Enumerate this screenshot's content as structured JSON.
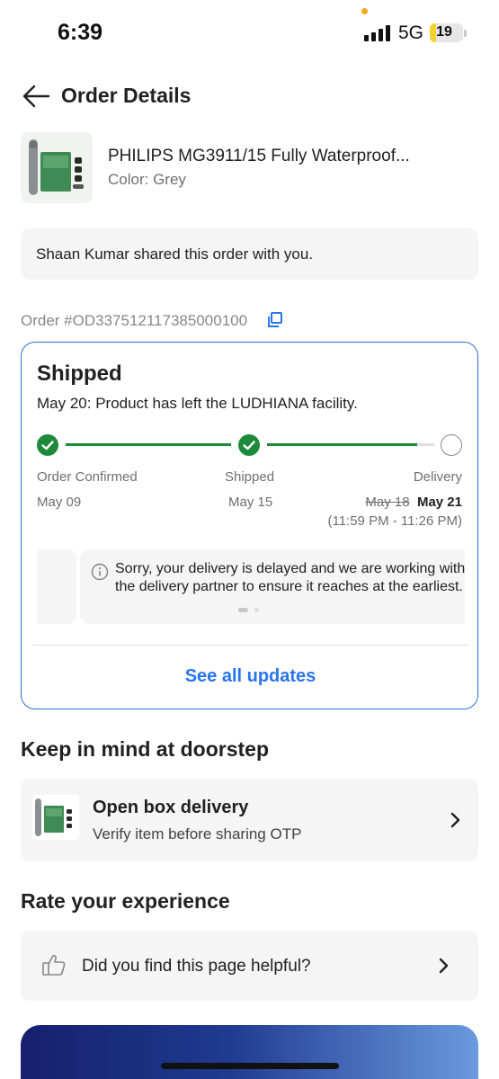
{
  "status_bar": {
    "time": "6:39",
    "network": "5G",
    "battery": "19",
    "battery_level": 0.19
  },
  "header": {
    "title": "Order Details"
  },
  "product": {
    "name": "PHILIPS MG3911/15 Fully Waterproof...",
    "color": "Color: Grey",
    "image": "philips-trimmer-kit-image"
  },
  "shared_notice": "Shaan Kumar shared this order with you.",
  "order": {
    "id": "Order #OD337512117385000100"
  },
  "shipment": {
    "status": "Shipped",
    "description": "May 20: Product has left the LUDHIANA facility.",
    "progress": 0.9,
    "steps": [
      {
        "label": "Order Confirmed",
        "date": "May 09",
        "done": true
      },
      {
        "label": "Shipped",
        "date": "May 15",
        "done": true
      },
      {
        "label": "Delivery",
        "old_date": "May 18",
        "date": "May 21",
        "done": false
      }
    ],
    "delivery_window": "(11:59 PM - 11:26 PM)",
    "delay_message": "Sorry, your delivery is delayed and we are working with\nthe delivery partner to ensure it reaches at the earliest.",
    "see_all": "See all updates"
  },
  "doorstep": {
    "section_title": "Keep in mind at doorstep",
    "title": "Open box delivery",
    "subtitle": "Verify item before sharing OTP"
  },
  "rating": {
    "section_title": "Rate your experience",
    "question": "Did you find this page helpful?"
  },
  "colors": {
    "accent": "#2874f0",
    "success": "#1d8a3a",
    "card_border": "#2f6fd6"
  }
}
